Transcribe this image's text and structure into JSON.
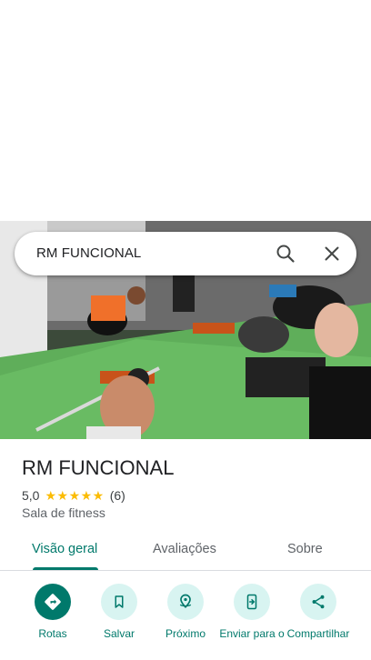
{
  "search": {
    "query": "RM FUNCIONAL"
  },
  "place": {
    "name": "RM FUNCIONAL",
    "rating": "5,0",
    "stars": "★★★★★",
    "review_count": "(6)",
    "category": "Sala de fitness"
  },
  "tabs": [
    {
      "label": "Visão geral",
      "active": true
    },
    {
      "label": "Avaliações",
      "active": false
    },
    {
      "label": "Sobre",
      "active": false
    }
  ],
  "actions": [
    {
      "label": "Rotas",
      "icon": "directions-icon"
    },
    {
      "label": "Salvar",
      "icon": "bookmark-icon"
    },
    {
      "label": "Próximo",
      "icon": "nearby-icon"
    },
    {
      "label": "Enviar para o",
      "icon": "send-to-phone-icon"
    },
    {
      "label": "Compartilhar",
      "icon": "share-icon"
    }
  ],
  "colors": {
    "accent": "#00796b",
    "accent_light": "#d8f4f1",
    "star": "#fbbc04",
    "text_primary": "#202124",
    "text_secondary": "#5f6368"
  }
}
